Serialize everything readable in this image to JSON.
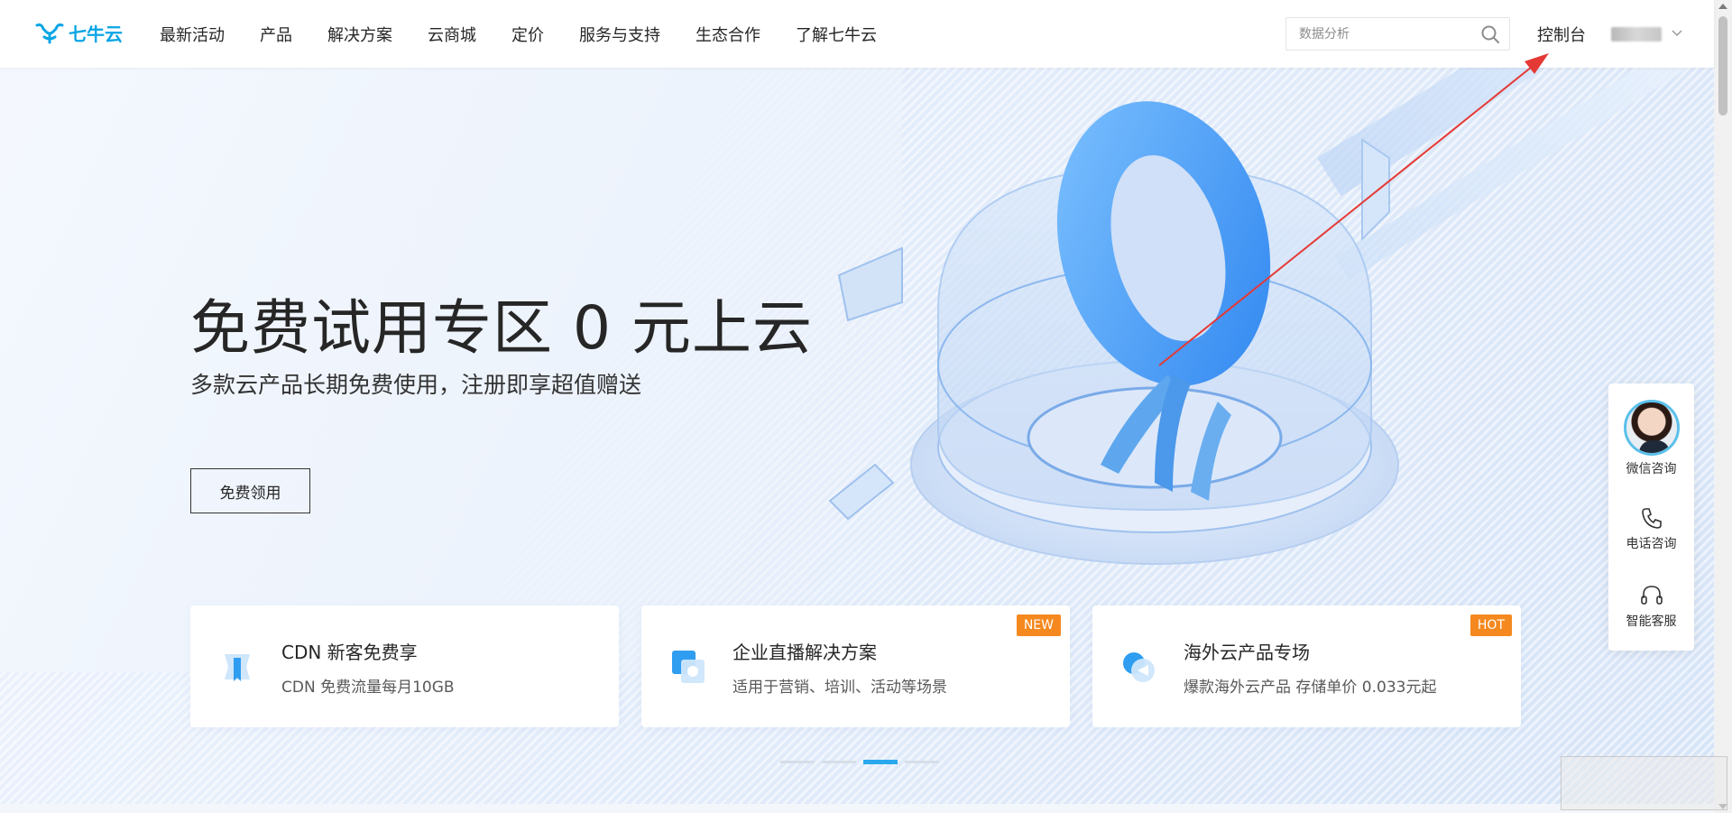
{
  "brand": {
    "name": "七牛云",
    "color": "#0aa5e5"
  },
  "nav": {
    "items": [
      "最新活动",
      "产品",
      "解决方案",
      "云商城",
      "定价",
      "服务与支持",
      "生态合作",
      "了解七牛云"
    ]
  },
  "search": {
    "placeholder": "数据分析",
    "icon": "search-icon"
  },
  "header_right": {
    "console_label": "控制台",
    "account_icon": "chevron-down-icon"
  },
  "hero": {
    "title": "免费试用专区 0 元上云",
    "subtitle": "多款云产品长期免费使用，注册即享超值赠送",
    "cta_label": "免费领用"
  },
  "cards": [
    {
      "title": "CDN 新客免费享",
      "desc": "CDN 免费流量每月10GB",
      "badge": "",
      "icon": "ribbon-award-icon"
    },
    {
      "title": "企业直播解决方案",
      "desc": "适用于营销、培训、活动等场景",
      "badge": "NEW",
      "badge_color": "#f5891f",
      "icon": "live-stream-icon"
    },
    {
      "title": "海外云产品专场",
      "desc": "爆款海外云产品 存储单价 0.033元起",
      "badge": "HOT",
      "badge_color": "#f5891f",
      "icon": "global-cloud-icon"
    }
  ],
  "carousel": {
    "count": 4,
    "active_index": 2,
    "active_color": "#29a8ef"
  },
  "float_panel": {
    "items": [
      {
        "label": "微信咨询",
        "icon": "agent-avatar"
      },
      {
        "label": "电话咨询",
        "icon": "phone-icon"
      },
      {
        "label": "智能客服",
        "icon": "headset-icon"
      }
    ]
  },
  "annotation": {
    "color": "#e53935"
  }
}
